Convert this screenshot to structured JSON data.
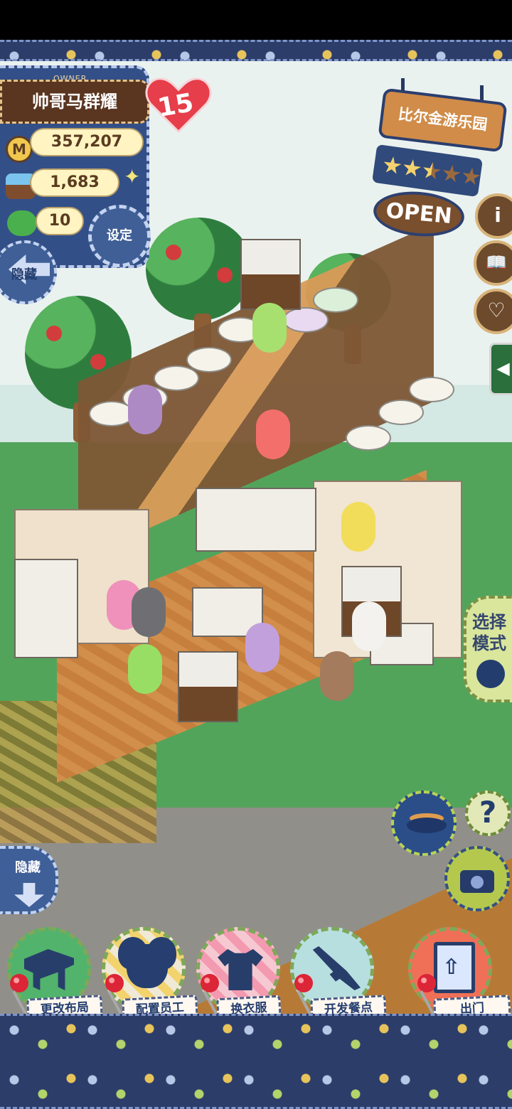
{
  "owner": {
    "label": "OWNER",
    "name": "帅哥马群耀"
  },
  "player": {
    "level": "15",
    "coins_symbol": "M",
    "coins": "357,207",
    "ingredients": "1,683",
    "clovers": "10"
  },
  "buttons": {
    "settings": "设定",
    "hide_top": "隐藏",
    "hide_bottom": "隐藏",
    "select_mode": "选择模式"
  },
  "park": {
    "name": "比尔金游乐园",
    "open": "OPEN",
    "rating": 2.5,
    "stars_total": 5
  },
  "side_actions": {
    "info": "i",
    "book": "📖",
    "favorite": "♡",
    "help": "?"
  },
  "menu": [
    {
      "label": "更改布局"
    },
    {
      "label": "配置员工"
    },
    {
      "label": "换衣服"
    },
    {
      "label": "开发餐点"
    },
    {
      "label": "出门"
    }
  ],
  "colors": {
    "denim": "#334f87",
    "wood": "#d08c48",
    "heart": "#e63e4a",
    "grass": "#53a45b"
  }
}
